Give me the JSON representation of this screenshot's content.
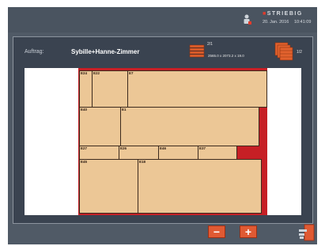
{
  "header": {
    "brand_mark": "■",
    "brand_name": "STRIEBIG",
    "date": "20. Jan. 2016",
    "time": "10:41:09",
    "icons": [
      "user-icon"
    ]
  },
  "job": {
    "label": "Auftrag:",
    "value": "Sybille+Hanne-Zimmer"
  },
  "board_info": {
    "count": "2/1",
    "dimensions": "2565.0 x 2073.2 x 19.0",
    "quantity": "1/2",
    "icons": [
      "board-stack-icon",
      "boards-stack-icon"
    ]
  },
  "parts": [
    {
      "id": "P24",
      "label": "E24"
    },
    {
      "id": "P22",
      "label": "E22"
    },
    {
      "id": "P7",
      "label": "E7"
    },
    {
      "id": "P40",
      "label": "E40"
    },
    {
      "id": "P1",
      "label": "E1"
    },
    {
      "id": "P27",
      "label": "E27"
    },
    {
      "id": "P26",
      "label": "E26"
    },
    {
      "id": "P46",
      "label": "E46"
    },
    {
      "id": "P37",
      "label": "E37"
    },
    {
      "id": "P45",
      "label": "E45"
    },
    {
      "id": "P18",
      "label": "E18"
    }
  ],
  "controls": {
    "minus_label": "−",
    "plus_label": "+",
    "icons": [
      "zoom-out-icon",
      "zoom-in-icon",
      "exit-door-icon"
    ]
  },
  "colors": {
    "board": "#c61f25",
    "part": "#ecc796",
    "accent": "#e05a33",
    "background": "#505a66"
  }
}
